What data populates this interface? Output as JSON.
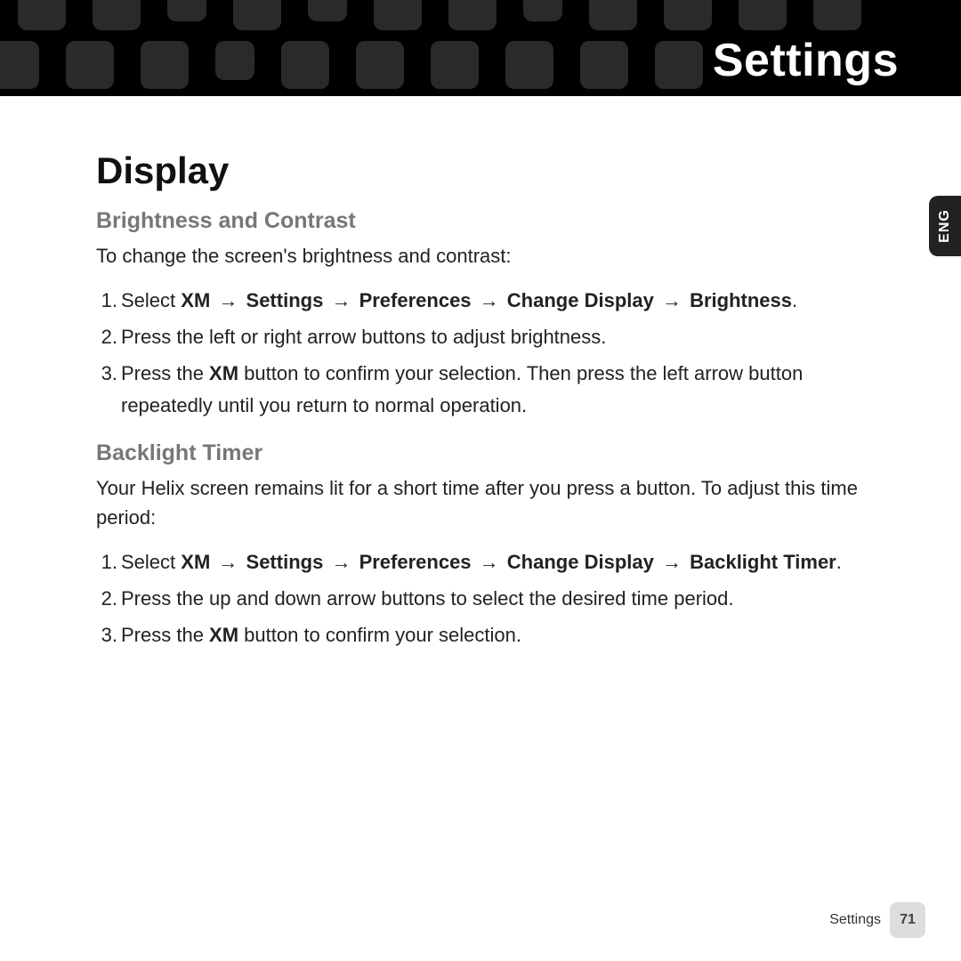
{
  "header": {
    "title": "Settings"
  },
  "sideTab": "ENG",
  "content": {
    "h1": "Display",
    "section1": {
      "h2": "Brightness and Contrast",
      "intro": "To change the screen's brightness and contrast:",
      "steps": {
        "s1_prefix": "1.",
        "s1_a": "Select ",
        "s1_b": "XM",
        "s1_c": "Settings",
        "s1_d": "Preferences",
        "s1_e": "Change Display",
        "s1_f": "Brightness",
        "s1_end": ".",
        "s2_prefix": "2.",
        "s2": "Press the left or right arrow buttons to adjust brightness.",
        "s3_prefix": "3.",
        "s3_a": "Press the ",
        "s3_b": "XM",
        "s3_c": " button to confirm your selection. Then press the left arrow button repeatedly until you return to normal operation."
      }
    },
    "section2": {
      "h2": "Backlight Timer",
      "intro": "Your Helix screen remains lit for a short time after you press a button. To adjust this time period:",
      "steps": {
        "s1_prefix": "1.",
        "s1_a": "Select ",
        "s1_b": "XM",
        "s1_c": "Settings",
        "s1_d": "Preferences",
        "s1_e": "Change Display",
        "s1_f": "Backlight Timer",
        "s1_end": ".",
        "s2_prefix": "2.",
        "s2": "Press the up and down arrow buttons to select the desired time period.",
        "s3_prefix": "3.",
        "s3_a": "Press the ",
        "s3_b": "XM",
        "s3_c": " button to confirm your selection."
      }
    }
  },
  "arrow": "→",
  "footer": {
    "text": "Settings",
    "page": "71"
  }
}
